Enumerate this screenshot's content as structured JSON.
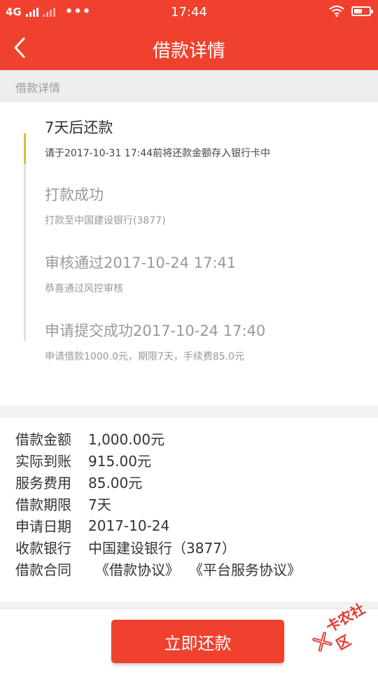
{
  "status_bar": {
    "network": "4G",
    "dots": "•••",
    "time": "17:44",
    "battery_level": 0.55
  },
  "nav": {
    "title": "借款详情"
  },
  "section": {
    "title": "借款详情"
  },
  "timeline": [
    {
      "title": "7天后还款",
      "desc": "请于2017-10-31 17:44前将还款金额存入银行卡中",
      "active": true
    },
    {
      "title": "打款成功",
      "desc": "打款至中国建设银行(3877)",
      "active": false
    },
    {
      "title": "审核通过2017-10-24 17:41",
      "desc": "恭喜通过风控审核",
      "active": false
    },
    {
      "title": "申请提交成功2017-10-24 17:40",
      "desc": "申请借款1000.0元，期限7天，手续费85.0元",
      "active": false
    }
  ],
  "details": {
    "amount": {
      "label": "借款金额",
      "value": "1,000.00元"
    },
    "received": {
      "label": "实际到账",
      "value": "915.00元"
    },
    "fee": {
      "label": "服务费用",
      "value": "85.00元"
    },
    "term": {
      "label": "借款期限",
      "value": "7天"
    },
    "apply_date": {
      "label": "申请日期",
      "value": "2017-10-24"
    },
    "bank": {
      "label": "收款银行",
      "value": "中国建设银行（3877）"
    },
    "contract": {
      "label": "借款合同",
      "link1": "《借款协议》",
      "link2": "《平台服务协议》"
    }
  },
  "actions": {
    "repay_label": "立即还款"
  },
  "watermark": {
    "text": "卡农社区"
  },
  "colors": {
    "brand": "#f0412f",
    "timeline_active": "#e0b93a"
  }
}
